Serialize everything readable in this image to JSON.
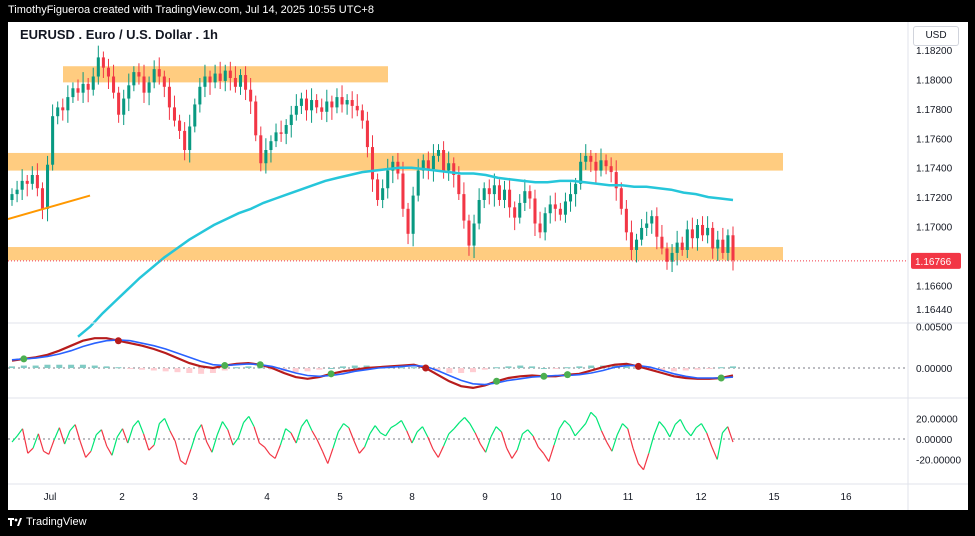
{
  "header": {
    "credit": "TimothyFigueroa created with TradingView.com, Jul 14, 2025 10:55 UTC+8",
    "symbol_title": "EURUSD . Euro / U.S. Dollar . 1h",
    "currency": "USD"
  },
  "footer": {
    "brand": "TradingView",
    "brand_icon": "tradingview-logo-icon"
  },
  "colors": {
    "up": "#089981",
    "down": "#f23645",
    "ma": "#26c6da",
    "zone": "#ffcc80",
    "trend": "#ff9800",
    "macd": "#2962ff",
    "signal": "#b71c1c",
    "cross_up": "#4caf50",
    "cross_down": "#b71c1c",
    "osc_up": "#00e676",
    "osc_down": "#f23645"
  },
  "chart_data": [
    {
      "type": "candlestick",
      "panel": "price",
      "title": "EURUSD . Euro / U.S. Dollar . 1h",
      "x_ticks": [
        "Jul",
        "2",
        "3",
        "4",
        "5",
        "8",
        "9",
        "10",
        "11",
        "12",
        "15",
        "16"
      ],
      "y_ticks": [
        "1.18200",
        "1.18000",
        "1.17800",
        "1.17600",
        "1.17400",
        "1.17200",
        "1.17000",
        "1.16600",
        "1.16440"
      ],
      "ylim": [
        1.1635,
        1.1835
      ],
      "last_price": "1.16766",
      "grid": false,
      "closes": [
        1.1722,
        1.1725,
        1.1731,
        1.1729,
        1.1735,
        1.1726,
        1.1712,
        1.1742,
        1.1775,
        1.1781,
        1.1779,
        1.1788,
        1.1794,
        1.1791,
        1.1797,
        1.1793,
        1.1802,
        1.1815,
        1.1808,
        1.1802,
        1.1791,
        1.1776,
        1.1787,
        1.1796,
        1.1805,
        1.1802,
        1.1791,
        1.1798,
        1.1807,
        1.1802,
        1.1795,
        1.1781,
        1.1772,
        1.1765,
        1.1752,
        1.1768,
        1.1783,
        1.1795,
        1.1802,
        1.1798,
        1.1804,
        1.1799,
        1.1806,
        1.1801,
        1.1795,
        1.1803,
        1.1793,
        1.1785,
        1.1762,
        1.1743,
        1.1752,
        1.1758,
        1.1764,
        1.1763,
        1.1769,
        1.1776,
        1.1782,
        1.1787,
        1.1779,
        1.1786,
        1.1781,
        1.1778,
        1.1785,
        1.1781,
        1.1788,
        1.1783,
        1.1786,
        1.1782,
        1.1779,
        1.1772,
        1.1754,
        1.1732,
        1.1718,
        1.1726,
        1.1738,
        1.1744,
        1.1736,
        1.1712,
        1.1695,
        1.1721,
        1.1738,
        1.1745,
        1.1739,
        1.1748,
        1.1752,
        1.1738,
        1.1743,
        1.1735,
        1.1722,
        1.1704,
        1.1687,
        1.1702,
        1.1718,
        1.1726,
        1.1722,
        1.1728,
        1.1718,
        1.1725,
        1.1713,
        1.1706,
        1.1716,
        1.1724,
        1.1719,
        1.1702,
        1.1696,
        1.1709,
        1.1715,
        1.1712,
        1.1708,
        1.1717,
        1.1722,
        1.1729,
        1.1744,
        1.1748,
        1.1744,
        1.1738,
        1.1745,
        1.1741,
        1.1737,
        1.1726,
        1.1712,
        1.1696,
        1.1684,
        1.1691,
        1.1699,
        1.1702,
        1.1707,
        1.1693,
        1.1685,
        1.1676,
        1.1682,
        1.1689,
        1.1684,
        1.1698,
        1.1692,
        1.1701,
        1.1694,
        1.1699,
        1.1685,
        1.1691,
        1.1682,
        1.1694,
        1.1677
      ],
      "overlays": [
        {
          "kind": "moving-average",
          "values": [
            1.1625,
            1.1632,
            1.1641,
            1.1649,
            1.1657,
            1.1665,
            1.1672,
            1.1679,
            1.1685,
            1.1691,
            1.1696,
            1.1701,
            1.1705,
            1.1709,
            1.1712,
            1.1716,
            1.1719,
            1.1722,
            1.1725,
            1.1728,
            1.1731,
            1.1733,
            1.1735,
            1.1737,
            1.1738,
            1.1739,
            1.174,
            1.174,
            1.1739,
            1.1738,
            1.1737,
            1.1736,
            1.1736,
            1.1735,
            1.1733,
            1.1732,
            1.1731,
            1.173,
            1.173,
            1.1731,
            1.1731,
            1.173,
            1.1729,
            1.1728,
            1.1728,
            1.1727,
            1.1727,
            1.1726,
            1.1725,
            1.1723,
            1.1722,
            1.172,
            1.1719,
            1.1718
          ]
        },
        {
          "kind": "support-resistance-zone",
          "y_low": 1.1798,
          "y_high": 1.1809
        },
        {
          "kind": "support-resistance-zone",
          "y_low": 1.1738,
          "y_high": 1.175
        },
        {
          "kind": "support-resistance-zone",
          "y_low": 1.1677,
          "y_high": 1.1686
        },
        {
          "kind": "trendline",
          "values": [
            1.1705,
            1.1721
          ]
        }
      ]
    },
    {
      "type": "line",
      "panel": "macd",
      "y_ticks": [
        "0.00500",
        "0.00000"
      ],
      "ylim": [
        -0.0035,
        0.0052
      ],
      "series": [
        {
          "values": [
            0.0009,
            0.0011,
            0.0013,
            0.0016,
            0.0021,
            0.0027,
            0.0033,
            0.0036,
            0.0036,
            0.0033,
            0.003,
            0.0027,
            0.0023,
            0.0018,
            0.0012,
            0.0006,
            0.0002,
            0.0,
            0.0003,
            0.0005,
            0.0006,
            0.0004,
            0.0,
            -0.0006,
            -0.0011,
            -0.0013,
            -0.0011,
            -0.0007,
            -0.0004,
            -0.0002,
            0.0,
            0.0001,
            0.0002,
            0.0003,
            0.0004,
            0.0,
            -0.0008,
            -0.0016,
            -0.0022,
            -0.0024,
            -0.0021,
            -0.0016,
            -0.0012,
            -0.001,
            -0.0009,
            -0.001,
            -0.001,
            -0.0008,
            -0.0007,
            -0.0003,
            0.0001,
            0.0004,
            0.0005,
            0.0002,
            -0.0002,
            -0.0006,
            -0.001,
            -0.0012,
            -0.0013,
            -0.0013,
            -0.0012,
            -0.0009
          ]
        },
        {
          "values": [
            0.001,
            0.0011,
            0.0012,
            0.0014,
            0.0017,
            0.0021,
            0.0026,
            0.003,
            0.0033,
            0.0034,
            0.0033,
            0.003,
            0.0027,
            0.0023,
            0.0018,
            0.0013,
            0.0008,
            0.0004,
            0.0003,
            0.0004,
            0.0005,
            0.0004,
            0.0002,
            -0.0002,
            -0.0006,
            -0.0009,
            -0.001,
            -0.0009,
            -0.0007,
            -0.0004,
            -0.0002,
            0.0,
            0.0001,
            0.0002,
            0.0003,
            0.0002,
            -0.0003,
            -0.0009,
            -0.0015,
            -0.0019,
            -0.002,
            -0.0018,
            -0.0015,
            -0.0013,
            -0.0011,
            -0.001,
            -0.0009,
            -0.0009,
            -0.0008,
            -0.0006,
            -0.0003,
            0.0001,
            0.0003,
            0.0003,
            0.0001,
            -0.0003,
            -0.0007,
            -0.001,
            -0.0012,
            -0.0012,
            -0.0012,
            -0.0011
          ]
        }
      ],
      "histogram": [
        0.0002,
        0.0003,
        0.0003,
        0.0004,
        0.0004,
        0.0004,
        0.0004,
        0.0003,
        0.0002,
        0.0001,
        -0.0001,
        -0.0002,
        -0.0003,
        -0.0004,
        -0.0005,
        -0.0006,
        -0.0007,
        -0.0006,
        -0.0003,
        0.0001,
        0.0002,
        0.0001,
        -0.0002,
        -0.0004,
        -0.0005,
        -0.0004,
        -0.0002,
        0.0,
        0.0002,
        0.0003,
        0.0003,
        0.0002,
        0.0001,
        0.0001,
        0.0001,
        -0.0002,
        -0.0004,
        -0.0006,
        -0.0006,
        -0.0005,
        -0.0002,
        0.0001,
        0.0002,
        0.0003,
        0.0002,
        0.0,
        -0.0001,
        0.0001,
        0.0002,
        0.0003,
        0.0003,
        0.0003,
        0.0002,
        0.0,
        -0.0002,
        -0.0003,
        -0.0004,
        -0.0003,
        -0.0002,
        -0.0001,
        0.0001,
        0.0002
      ]
    },
    {
      "type": "line",
      "panel": "oscillator",
      "y_ticks": [
        "20.00000",
        "0.00000",
        "-20.00000"
      ],
      "ylim": [
        -42,
        38
      ],
      "series": [
        {
          "values": [
            -3,
            3,
            10,
            -14,
            -9,
            5,
            -12,
            -15,
            -1,
            11,
            -5,
            8,
            14,
            -3,
            -18,
            -12,
            4,
            9,
            -7,
            -16,
            2,
            10,
            -4,
            12,
            18,
            5,
            -11,
            -6,
            15,
            20,
            8,
            -2,
            -21,
            -25,
            -10,
            6,
            14,
            -3,
            -13,
            4,
            17,
            9,
            -6,
            1,
            16,
            22,
            12,
            -4,
            -8,
            -15,
            -19,
            -6,
            10,
            6,
            -4,
            12,
            19,
            8,
            -1,
            -12,
            -24,
            -9,
            7,
            15,
            11,
            -2,
            -14,
            -8,
            5,
            13,
            6,
            3,
            11,
            14,
            18,
            8,
            -4,
            7,
            12,
            2,
            -10,
            -18,
            -7,
            5,
            10,
            16,
            21,
            15,
            6,
            -5,
            -13,
            2,
            12,
            7,
            -9,
            -19,
            -11,
            5,
            9,
            3,
            -8,
            -14,
            -22,
            -6,
            10,
            18,
            13,
            3,
            9,
            15,
            26,
            21,
            8,
            -3,
            -12,
            4,
            15,
            10,
            -9,
            -24,
            -30,
            -14,
            4,
            17,
            11,
            2,
            14,
            19,
            9,
            3,
            11,
            15,
            6,
            -8,
            -20,
            6,
            12,
            -3
          ]
        }
      ]
    }
  ]
}
